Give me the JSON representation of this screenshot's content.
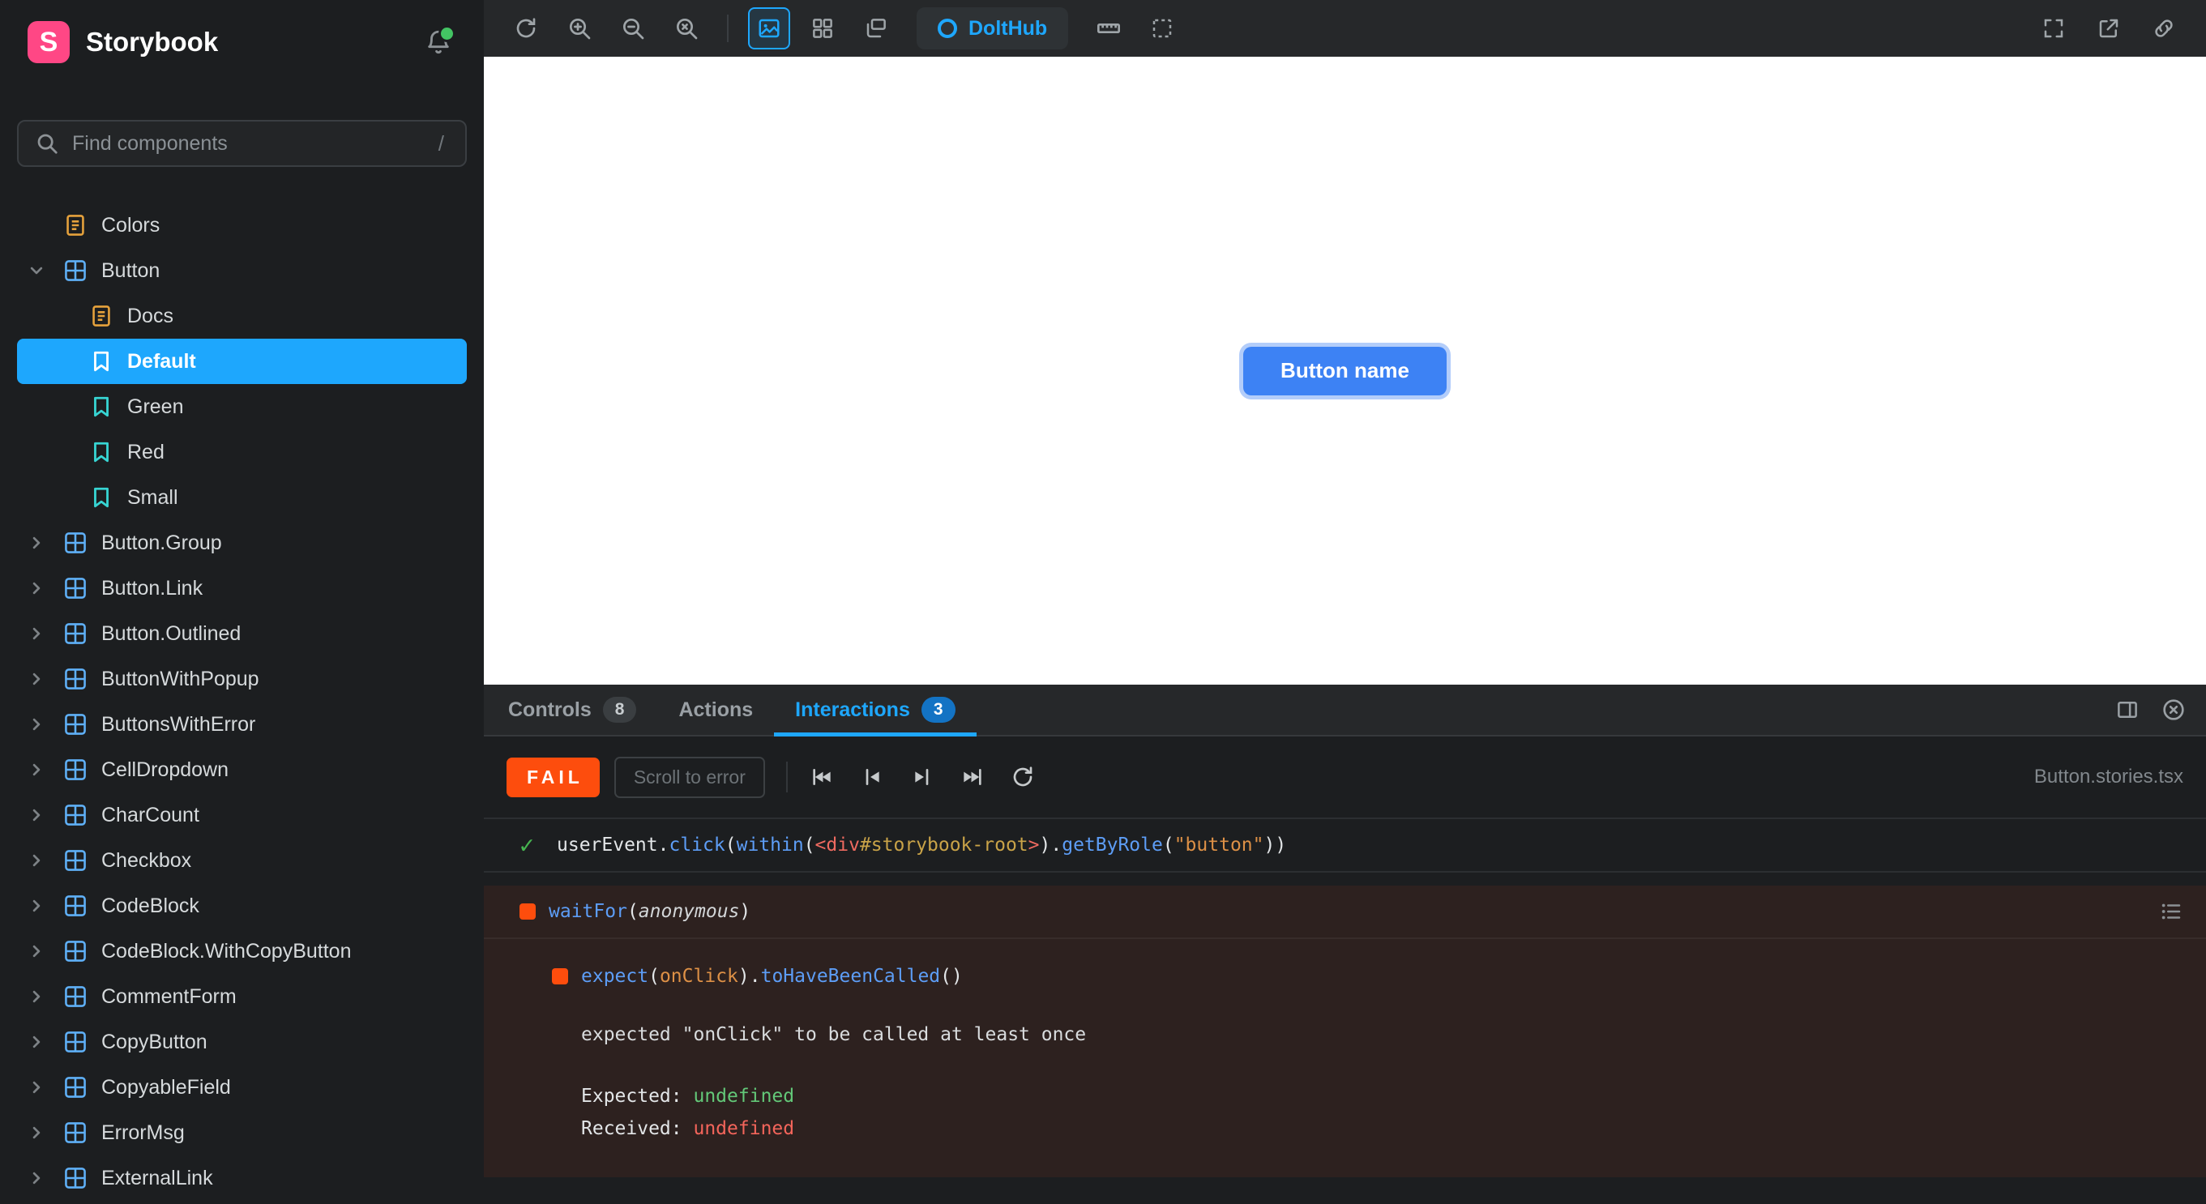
{
  "brand": {
    "name": "Storybook",
    "logo_letter": "S"
  },
  "sidebar": {
    "search": {
      "placeholder": "Find components",
      "shortcut": "/"
    },
    "items": [
      {
        "label": "Colors",
        "kind": "doc",
        "depth": 0
      },
      {
        "label": "Button",
        "kind": "component",
        "depth": 0,
        "expanded": true
      },
      {
        "label": "Docs",
        "kind": "docs",
        "depth": 1
      },
      {
        "label": "Default",
        "kind": "story",
        "depth": 1,
        "selected": true
      },
      {
        "label": "Green",
        "kind": "story",
        "depth": 1
      },
      {
        "label": "Red",
        "kind": "story",
        "depth": 1
      },
      {
        "label": "Small",
        "kind": "story",
        "depth": 1
      },
      {
        "label": "Button.Group",
        "kind": "component",
        "depth": 0
      },
      {
        "label": "Button.Link",
        "kind": "component",
        "depth": 0
      },
      {
        "label": "Button.Outlined",
        "kind": "component",
        "depth": 0
      },
      {
        "label": "ButtonWithPopup",
        "kind": "component",
        "depth": 0
      },
      {
        "label": "ButtonsWithError",
        "kind": "component",
        "depth": 0
      },
      {
        "label": "CellDropdown",
        "kind": "component",
        "depth": 0
      },
      {
        "label": "CharCount",
        "kind": "component",
        "depth": 0
      },
      {
        "label": "Checkbox",
        "kind": "component",
        "depth": 0
      },
      {
        "label": "CodeBlock",
        "kind": "component",
        "depth": 0
      },
      {
        "label": "CodeBlock.WithCopyButton",
        "kind": "component",
        "depth": 0
      },
      {
        "label": "CommentForm",
        "kind": "component",
        "depth": 0
      },
      {
        "label": "CopyButton",
        "kind": "component",
        "depth": 0
      },
      {
        "label": "CopyableField",
        "kind": "component",
        "depth": 0
      },
      {
        "label": "ErrorMsg",
        "kind": "component",
        "depth": 0
      },
      {
        "label": "ExternalLink",
        "kind": "component",
        "depth": 0
      }
    ]
  },
  "toolbar": {
    "theme_switcher": {
      "label": "DoltHub"
    }
  },
  "canvas": {
    "button_label": "Button name"
  },
  "panel": {
    "tabs": [
      {
        "label": "Controls",
        "badge": "8"
      },
      {
        "label": "Actions"
      },
      {
        "label": "Interactions",
        "badge": "3",
        "active": true
      }
    ],
    "subtoolbar": {
      "status": "FAIL",
      "scroll_button": "Scroll to error",
      "file": "Button.stories.tsx"
    },
    "interactions": {
      "step1": [
        {
          "t": "userEvent.",
          "c": "fg"
        },
        {
          "t": "click",
          "c": "blue"
        },
        {
          "t": "(",
          "c": "fg"
        },
        {
          "t": "within",
          "c": "blue"
        },
        {
          "t": "(",
          "c": "fg"
        },
        {
          "t": "<div",
          "c": "red"
        },
        {
          "t": "#storybook-root",
          "c": "yellow"
        },
        {
          "t": ">",
          "c": "red"
        },
        {
          "t": ").",
          "c": "fg"
        },
        {
          "t": "getByRole",
          "c": "blue"
        },
        {
          "t": "(",
          "c": "fg"
        },
        {
          "t": "\"button\"",
          "c": "orange"
        },
        {
          "t": "))",
          "c": "fg"
        }
      ],
      "step2": [
        {
          "t": "waitFor",
          "c": "blue"
        },
        {
          "t": "(",
          "c": "fg"
        },
        {
          "t": "anonymous",
          "c": "italic"
        },
        {
          "t": ")",
          "c": "fg"
        }
      ],
      "step3": [
        {
          "t": "expect",
          "c": "blue"
        },
        {
          "t": "(",
          "c": "fg"
        },
        {
          "t": "onClick",
          "c": "orange"
        },
        {
          "t": ").",
          "c": "fg"
        },
        {
          "t": "toHaveBeenCalled",
          "c": "blue"
        },
        {
          "t": "()",
          "c": "fg"
        }
      ],
      "error_message": "expected \"onClick\" to be called at least once",
      "expected_line": [
        {
          "t": "Expected: ",
          "c": "fg"
        },
        {
          "t": "undefined",
          "c": "green"
        }
      ],
      "received_line": [
        {
          "t": "Received: ",
          "c": "fg"
        },
        {
          "t": "undefined",
          "c": "redv"
        }
      ]
    }
  },
  "colors": {
    "accent_blue": "#1ea7fd",
    "brand_pink": "#ff4785",
    "fail_orange": "#fd4d0d",
    "pass_green": "#46b450",
    "story_teal": "#37d5d3",
    "docs_orange": "#e6a23c",
    "component_blue": "#5fb0f7",
    "canvas_button_blue": "#3d82f4",
    "notification_green": "#43c463"
  }
}
